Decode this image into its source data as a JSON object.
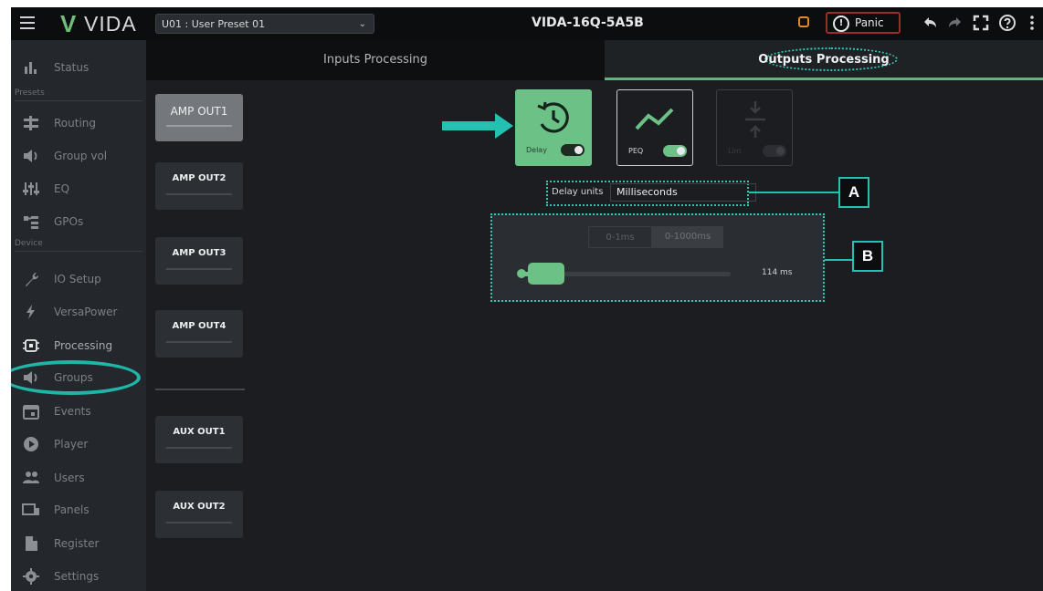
{
  "header": {
    "logo_mark": "V",
    "logo_text": "VIDA",
    "preset": "U01 : User Preset 01",
    "device_name": "VIDA-16Q-5A5B",
    "panic_icon": "!",
    "panic_label": "Panic",
    "icons": [
      "menu-icon",
      "warning-square-icon",
      "panic-icon",
      "undo-icon",
      "redo-icon",
      "fullscreen-icon",
      "help-icon",
      "more-icon"
    ]
  },
  "sidebar": {
    "items_top": [
      {
        "label": "Status",
        "icon": "status-icon"
      }
    ],
    "section_presets": "Presets",
    "items_presets": [
      {
        "label": "Routing",
        "icon": "routing-icon"
      },
      {
        "label": "Group vol",
        "icon": "speaker-icon"
      },
      {
        "label": "EQ",
        "icon": "eq-icon"
      },
      {
        "label": "GPOs",
        "icon": "gpo-icon"
      }
    ],
    "section_device": "Device",
    "items_device": [
      {
        "label": "IO Setup",
        "icon": "wrench-icon"
      },
      {
        "label": "VersaPower",
        "icon": "bolt-icon"
      },
      {
        "label": "Processing",
        "icon": "chip-icon",
        "active": true
      },
      {
        "label": "Groups",
        "icon": "speaker-icon"
      },
      {
        "label": "Events",
        "icon": "calendar-icon"
      },
      {
        "label": "Player",
        "icon": "play-icon"
      },
      {
        "label": "Users",
        "icon": "users-icon"
      },
      {
        "label": "Panels",
        "icon": "panels-icon"
      },
      {
        "label": "Register",
        "icon": "document-icon"
      },
      {
        "label": "Settings",
        "icon": "gear-icon"
      }
    ]
  },
  "tabs": {
    "inputs": "Inputs Processing",
    "outputs": "Outputs Processing",
    "selected": "outputs"
  },
  "channels": {
    "amp": [
      "AMP OUT1",
      "AMP OUT2",
      "AMP OUT3",
      "AMP OUT4"
    ],
    "aux": [
      "AUX OUT1",
      "AUX OUT2"
    ],
    "selected": "AMP OUT1"
  },
  "blocks": {
    "delay": {
      "label": "Delay",
      "enabled": true
    },
    "peq": {
      "label": "PEQ",
      "enabled": true
    },
    "limiter": {
      "label": "Lim",
      "enabled": false
    }
  },
  "delay_units": {
    "label": "Delay units",
    "value": "Milliseconds"
  },
  "slider": {
    "ranges": [
      "0-1ms",
      "0-1000ms"
    ],
    "selected_range": "0-1000ms",
    "value": 114,
    "max": 1000,
    "value_label": "114 ms"
  },
  "callouts": {
    "a": "A",
    "b": "B"
  },
  "colors": {
    "accent_green": "#6cc187",
    "annotation_teal": "#22c1b2",
    "panic_border": "#9a2e2e",
    "warning_orange": "#e08a2a"
  }
}
